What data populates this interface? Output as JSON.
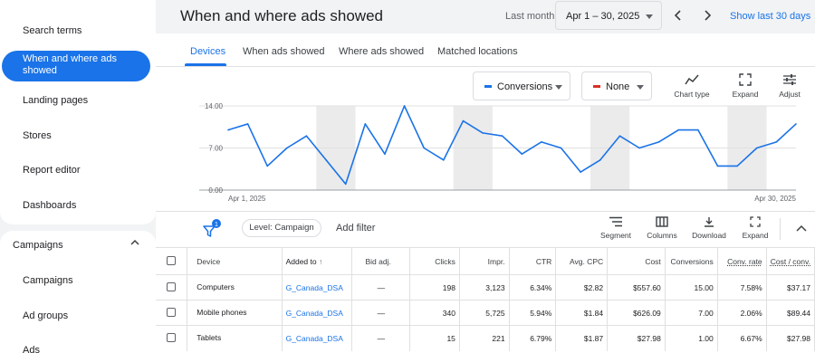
{
  "sidebar": {
    "items": [
      {
        "label": "Search terms"
      },
      {
        "label": "When and where ads showed"
      },
      {
        "label": "Landing pages"
      },
      {
        "label": "Stores"
      },
      {
        "label": "Report editor"
      },
      {
        "label": "Dashboards"
      }
    ],
    "section": {
      "label": "Campaigns"
    },
    "sub_items": [
      {
        "label": "Campaigns"
      },
      {
        "label": "Ad groups"
      },
      {
        "label": "Ads"
      }
    ]
  },
  "header": {
    "title": "When and where ads showed",
    "date_label": "Last month",
    "date_range": "Apr 1 – 30, 2025",
    "show_last": "Show last 30 days"
  },
  "tabs": [
    {
      "label": "Devices"
    },
    {
      "label": "When ads showed"
    },
    {
      "label": "Where ads showed"
    },
    {
      "label": "Matched locations"
    }
  ],
  "series_selectors": [
    {
      "label": "Conversions",
      "color": "#1a73e8"
    },
    {
      "label": "None",
      "color": "#d93025"
    }
  ],
  "chart_tools": [
    {
      "label": "Chart type",
      "icon": "chart-type-icon"
    },
    {
      "label": "Expand",
      "icon": "expand-icon"
    },
    {
      "label": "Adjust",
      "icon": "adjust-icon"
    }
  ],
  "chart_data": {
    "type": "line",
    "x_start": "Apr 1, 2025",
    "x_end": "Apr 30, 2025",
    "y_ticks": [
      "14.00",
      "7.00",
      "0.00"
    ],
    "ylim": [
      0,
      14
    ],
    "grid": true,
    "series": [
      {
        "name": "Conversions",
        "color": "#1a73e8",
        "values": [
          10,
          11,
          4,
          7,
          9,
          5,
          1,
          11,
          6,
          14,
          7,
          5,
          11.5,
          9.5,
          9,
          6,
          8,
          7,
          3,
          5,
          9,
          7,
          8,
          10,
          10,
          4,
          4,
          7,
          8,
          11
        ]
      }
    ],
    "shaded_days": [
      5,
      6,
      12,
      13,
      19,
      20,
      26,
      27
    ]
  },
  "table_toolbar": {
    "filter_badge": "1",
    "level": "Level: Campaign",
    "add_filter": "Add filter",
    "tools": [
      {
        "label": "Segment",
        "icon": "segment-icon"
      },
      {
        "label": "Columns",
        "icon": "columns-icon"
      },
      {
        "label": "Download",
        "icon": "download-icon"
      },
      {
        "label": "Expand",
        "icon": "expand-icon"
      }
    ]
  },
  "table": {
    "columns": [
      "Device",
      "Added to",
      "Bid adj.",
      "Clicks",
      "Impr.",
      "CTR",
      "Avg. CPC",
      "Cost",
      "Conversions",
      "Conv. rate",
      "Cost / conv."
    ],
    "rows": [
      [
        "Computers",
        "G_Canada_DSA",
        "—",
        "198",
        "3,123",
        "6.34%",
        "$2.82",
        "$557.60",
        "15.00",
        "7.58%",
        "$37.17"
      ],
      [
        "Mobile phones",
        "G_Canada_DSA",
        "—",
        "340",
        "5,725",
        "5.94%",
        "$1.84",
        "$626.09",
        "7.00",
        "2.06%",
        "$89.44"
      ],
      [
        "Tablets",
        "G_Canada_DSA",
        "—",
        "15",
        "221",
        "6.79%",
        "$1.87",
        "$27.98",
        "1.00",
        "6.67%",
        "$27.98"
      ]
    ]
  }
}
